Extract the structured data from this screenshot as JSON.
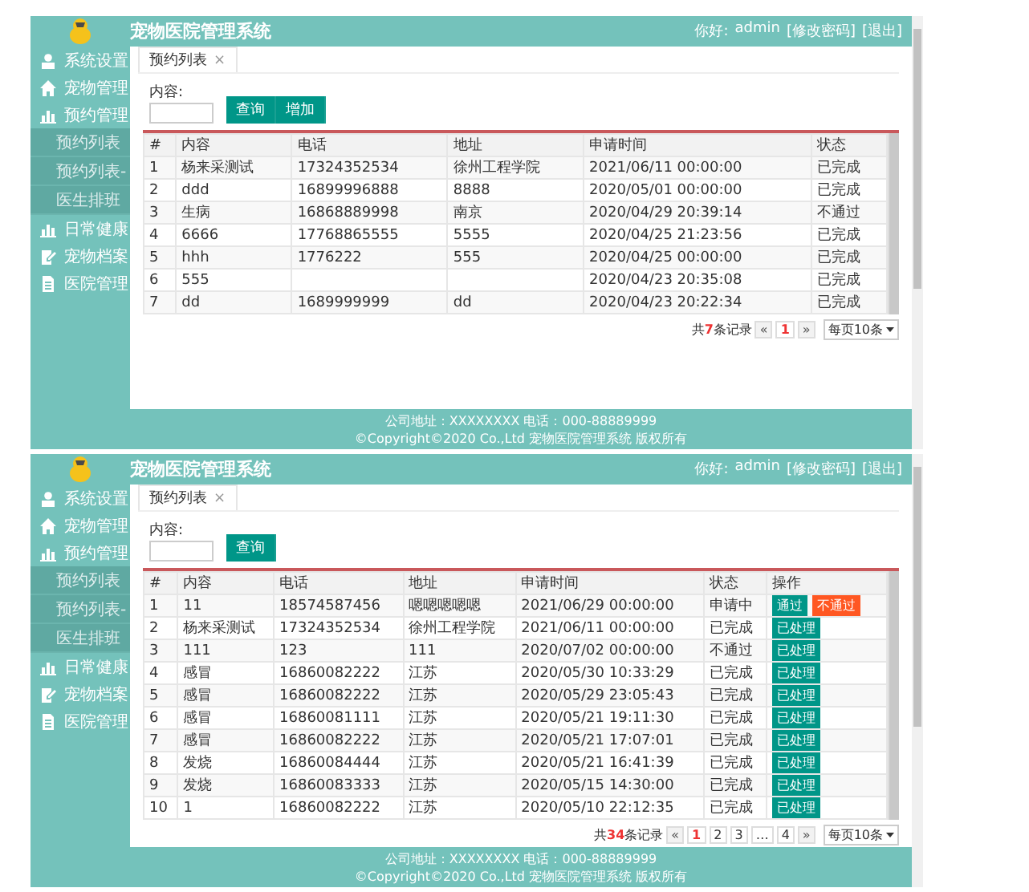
{
  "screenshots": [
    {
      "app_title": "宠物医院管理系统",
      "greeting": "你好:",
      "username": "admin",
      "header_links": [
        "[修改密码]",
        "[退出]"
      ],
      "sidebar": [
        {
          "label": "系统设置"
        },
        {
          "label": "宠物管理"
        },
        {
          "label": "预约管理",
          "children": [
            {
              "label": "预约列表"
            },
            {
              "label": "预约列表-"
            },
            {
              "label": "医生排班"
            }
          ]
        },
        {
          "label": "日常健康"
        },
        {
          "label": "宠物档案"
        },
        {
          "label": "医院管理"
        }
      ],
      "tab": {
        "label": "预约列表",
        "close": "×"
      },
      "search": {
        "label": "内容:",
        "buttons": [
          "查询",
          "增加"
        ]
      },
      "table": {
        "columns": [
          "#",
          "内容",
          "电话",
          "地址",
          "申请时间",
          "状态"
        ],
        "rows": [
          {
            "no": "1",
            "content": "杨来采测试",
            "phone": "17324352534",
            "address": "徐州工程学院",
            "time": "2021/06/11 00:00:00",
            "status": "已完成"
          },
          {
            "no": "2",
            "content": "ddd",
            "phone": "16899996888",
            "address": "8888",
            "time": "2020/05/01 00:00:00",
            "status": "已完成"
          },
          {
            "no": "3",
            "content": "生病",
            "phone": "16868889998",
            "address": "南京",
            "time": "2020/04/29 20:39:14",
            "status": "不通过"
          },
          {
            "no": "4",
            "content": "6666",
            "phone": "17768865555",
            "address": "5555",
            "time": "2020/04/25 21:23:56",
            "status": "已完成"
          },
          {
            "no": "5",
            "content": "hhh",
            "phone": "1776222",
            "address": "555",
            "time": "2020/04/25 00:00:00",
            "status": "已完成"
          },
          {
            "no": "6",
            "content": "555",
            "time": "2020/04/23 20:35:08",
            "status": "已完成"
          },
          {
            "no": "7",
            "content": "dd",
            "phone": "1689999999",
            "address": "dd",
            "time": "2020/04/23 20:22:34",
            "status": "已完成"
          }
        ]
      },
      "pager": {
        "summary": "共**7**条记录",
        "prev": "«",
        "pages": [
          {
            "label": "1",
            "selected": true
          }
        ],
        "next": "»",
        "page_size": "每页10条"
      },
      "footer": [
        "公司地址：XXXXXXXX 电话：000-88889999",
        "©Copyright©2020 Co.,Ltd 宠物医院管理系统 版权所有"
      ]
    },
    {
      "app_title": "宠物医院管理系统",
      "greeting": "你好:",
      "username": "admin",
      "header_links": [
        "[修改密码]",
        "[退出]"
      ],
      "sidebar": [
        {
          "label": "系统设置"
        },
        {
          "label": "宠物管理"
        },
        {
          "label": "预约管理",
          "children": [
            {
              "label": "预约列表"
            },
            {
              "label": "预约列表-"
            },
            {
              "label": "医生排班"
            }
          ]
        },
        {
          "label": "日常健康"
        },
        {
          "label": "宠物档案"
        },
        {
          "label": "医院管理"
        }
      ],
      "tab": {
        "label": "预约列表",
        "close": "×"
      },
      "search": {
        "label": "内容:",
        "buttons": [
          "查询"
        ]
      },
      "table": {
        "columns": [
          "#",
          "内容",
          "电话",
          "地址",
          "申请时间",
          "状态",
          "操作"
        ],
        "rows": [
          {
            "no": "1",
            "content": "11",
            "phone": "18574587456",
            "address": "嗯嗯嗯嗯嗯",
            "time": "2021/06/29 00:00:00",
            "status": "申请中",
            "actions": [
              {
                "label": "通过",
                "kind": "approve"
              },
              {
                "label": "不通过",
                "kind": "reject"
              }
            ]
          },
          {
            "no": "2",
            "content": "杨来采测试",
            "phone": "17324352534",
            "address": "徐州工程学院",
            "time": "2021/06/11 00:00:00",
            "status": "已完成",
            "actions": [
              {
                "label": "已处理",
                "kind": "done"
              }
            ]
          },
          {
            "no": "3",
            "content": "111",
            "phone": "123",
            "address": "111",
            "time": "2020/07/02 00:00:00",
            "status": "不通过",
            "actions": [
              {
                "label": "已处理",
                "kind": "done"
              }
            ]
          },
          {
            "no": "4",
            "content": "感冒",
            "phone": "16860082222",
            "address": "江苏",
            "time": "2020/05/30 10:33:29",
            "status": "已完成",
            "actions": [
              {
                "label": "已处理",
                "kind": "done"
              }
            ]
          },
          {
            "no": "5",
            "content": "感冒",
            "phone": "16860082222",
            "address": "江苏",
            "time": "2020/05/29 23:05:43",
            "status": "已完成",
            "actions": [
              {
                "label": "已处理",
                "kind": "done"
              }
            ]
          },
          {
            "no": "6",
            "content": "感冒",
            "phone": "16860081111",
            "address": "江苏",
            "time": "2020/05/21 19:11:30",
            "status": "已完成",
            "actions": [
              {
                "label": "已处理",
                "kind": "done"
              }
            ]
          },
          {
            "no": "7",
            "content": "感冒",
            "phone": "16860082222",
            "address": "江苏",
            "time": "2020/05/21 17:07:01",
            "status": "已完成",
            "actions": [
              {
                "label": "已处理",
                "kind": "done"
              }
            ]
          },
          {
            "no": "8",
            "content": "发烧",
            "phone": "16860084444",
            "address": "江苏",
            "time": "2020/05/21 16:41:39",
            "status": "已完成",
            "actions": [
              {
                "label": "已处理",
                "kind": "done"
              }
            ]
          },
          {
            "no": "9",
            "content": "发烧",
            "phone": "16860083333",
            "address": "江苏",
            "time": "2020/05/15 14:30:00",
            "status": "已完成",
            "actions": [
              {
                "label": "已处理",
                "kind": "done"
              }
            ]
          },
          {
            "no": "10",
            "content": "1",
            "phone": "16860082222",
            "address": "江苏",
            "time": "2020/05/10 22:12:35",
            "status": "已完成",
            "actions": [
              {
                "label": "已处理",
                "kind": "done"
              }
            ]
          }
        ]
      },
      "pager": {
        "summary": "共**34**条记录",
        "prev": "«",
        "pages": [
          {
            "label": "1",
            "selected": true
          },
          {
            "label": "2",
            "selected": false
          },
          {
            "label": "3",
            "selected": false
          },
          {
            "label": "…",
            "selected": false
          },
          {
            "label": "4",
            "selected": false
          }
        ],
        "next": "»",
        "page_size": "每页10条"
      },
      "footer": [
        "公司地址：XXXXXXXX 电话：000-88889999",
        "©Copyright©2020 Co.,Ltd 宠物医院管理系统 版权所有"
      ]
    }
  ]
}
